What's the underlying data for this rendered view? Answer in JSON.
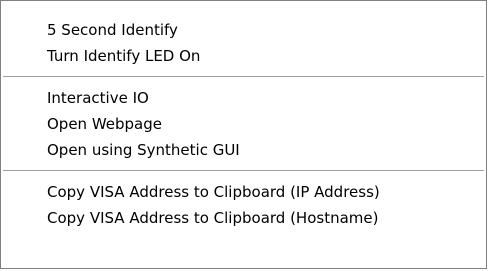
{
  "menu": {
    "groups": [
      {
        "items": [
          {
            "label": "5 Second Identify"
          },
          {
            "label": "Turn Identify LED On"
          }
        ]
      },
      {
        "items": [
          {
            "label": "Interactive IO"
          },
          {
            "label": "Open Webpage"
          },
          {
            "label": "Open using Synthetic GUI"
          }
        ]
      },
      {
        "items": [
          {
            "label": "Copy VISA Address to Clipboard (IP Address)"
          },
          {
            "label": "Copy VISA Address to Clipboard (Hostname)"
          }
        ]
      }
    ]
  }
}
